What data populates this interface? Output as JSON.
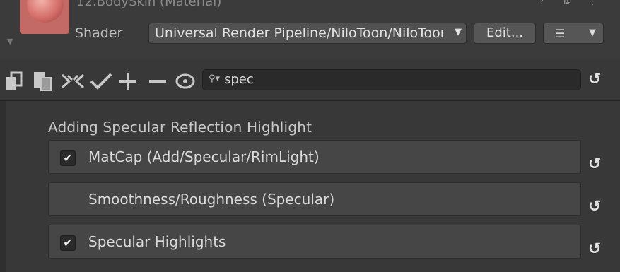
{
  "header": {
    "material_title": "12.BodySkin (Material)",
    "shader_label": "Shader",
    "shader_value": "Universal Render Pipeline/NiloToon/NiloToon_Character",
    "edit_label": "Edit...",
    "menu_icon": "list-icon"
  },
  "toolbar": {
    "icons": [
      "copy-icon",
      "paste-icon",
      "collapse-icon",
      "check-icon",
      "plus-icon",
      "minus-icon",
      "eye-icon"
    ],
    "search_value": "spec"
  },
  "section": {
    "title": "Adding Specular Reflection Highlight",
    "rows": [
      {
        "label": "MatCap (Add/Specular/RimLight)",
        "checked": true
      },
      {
        "label": "Smoothness/Roughness (Specular)",
        "checked": false
      },
      {
        "label": "Specular Highlights",
        "checked": true
      }
    ]
  }
}
